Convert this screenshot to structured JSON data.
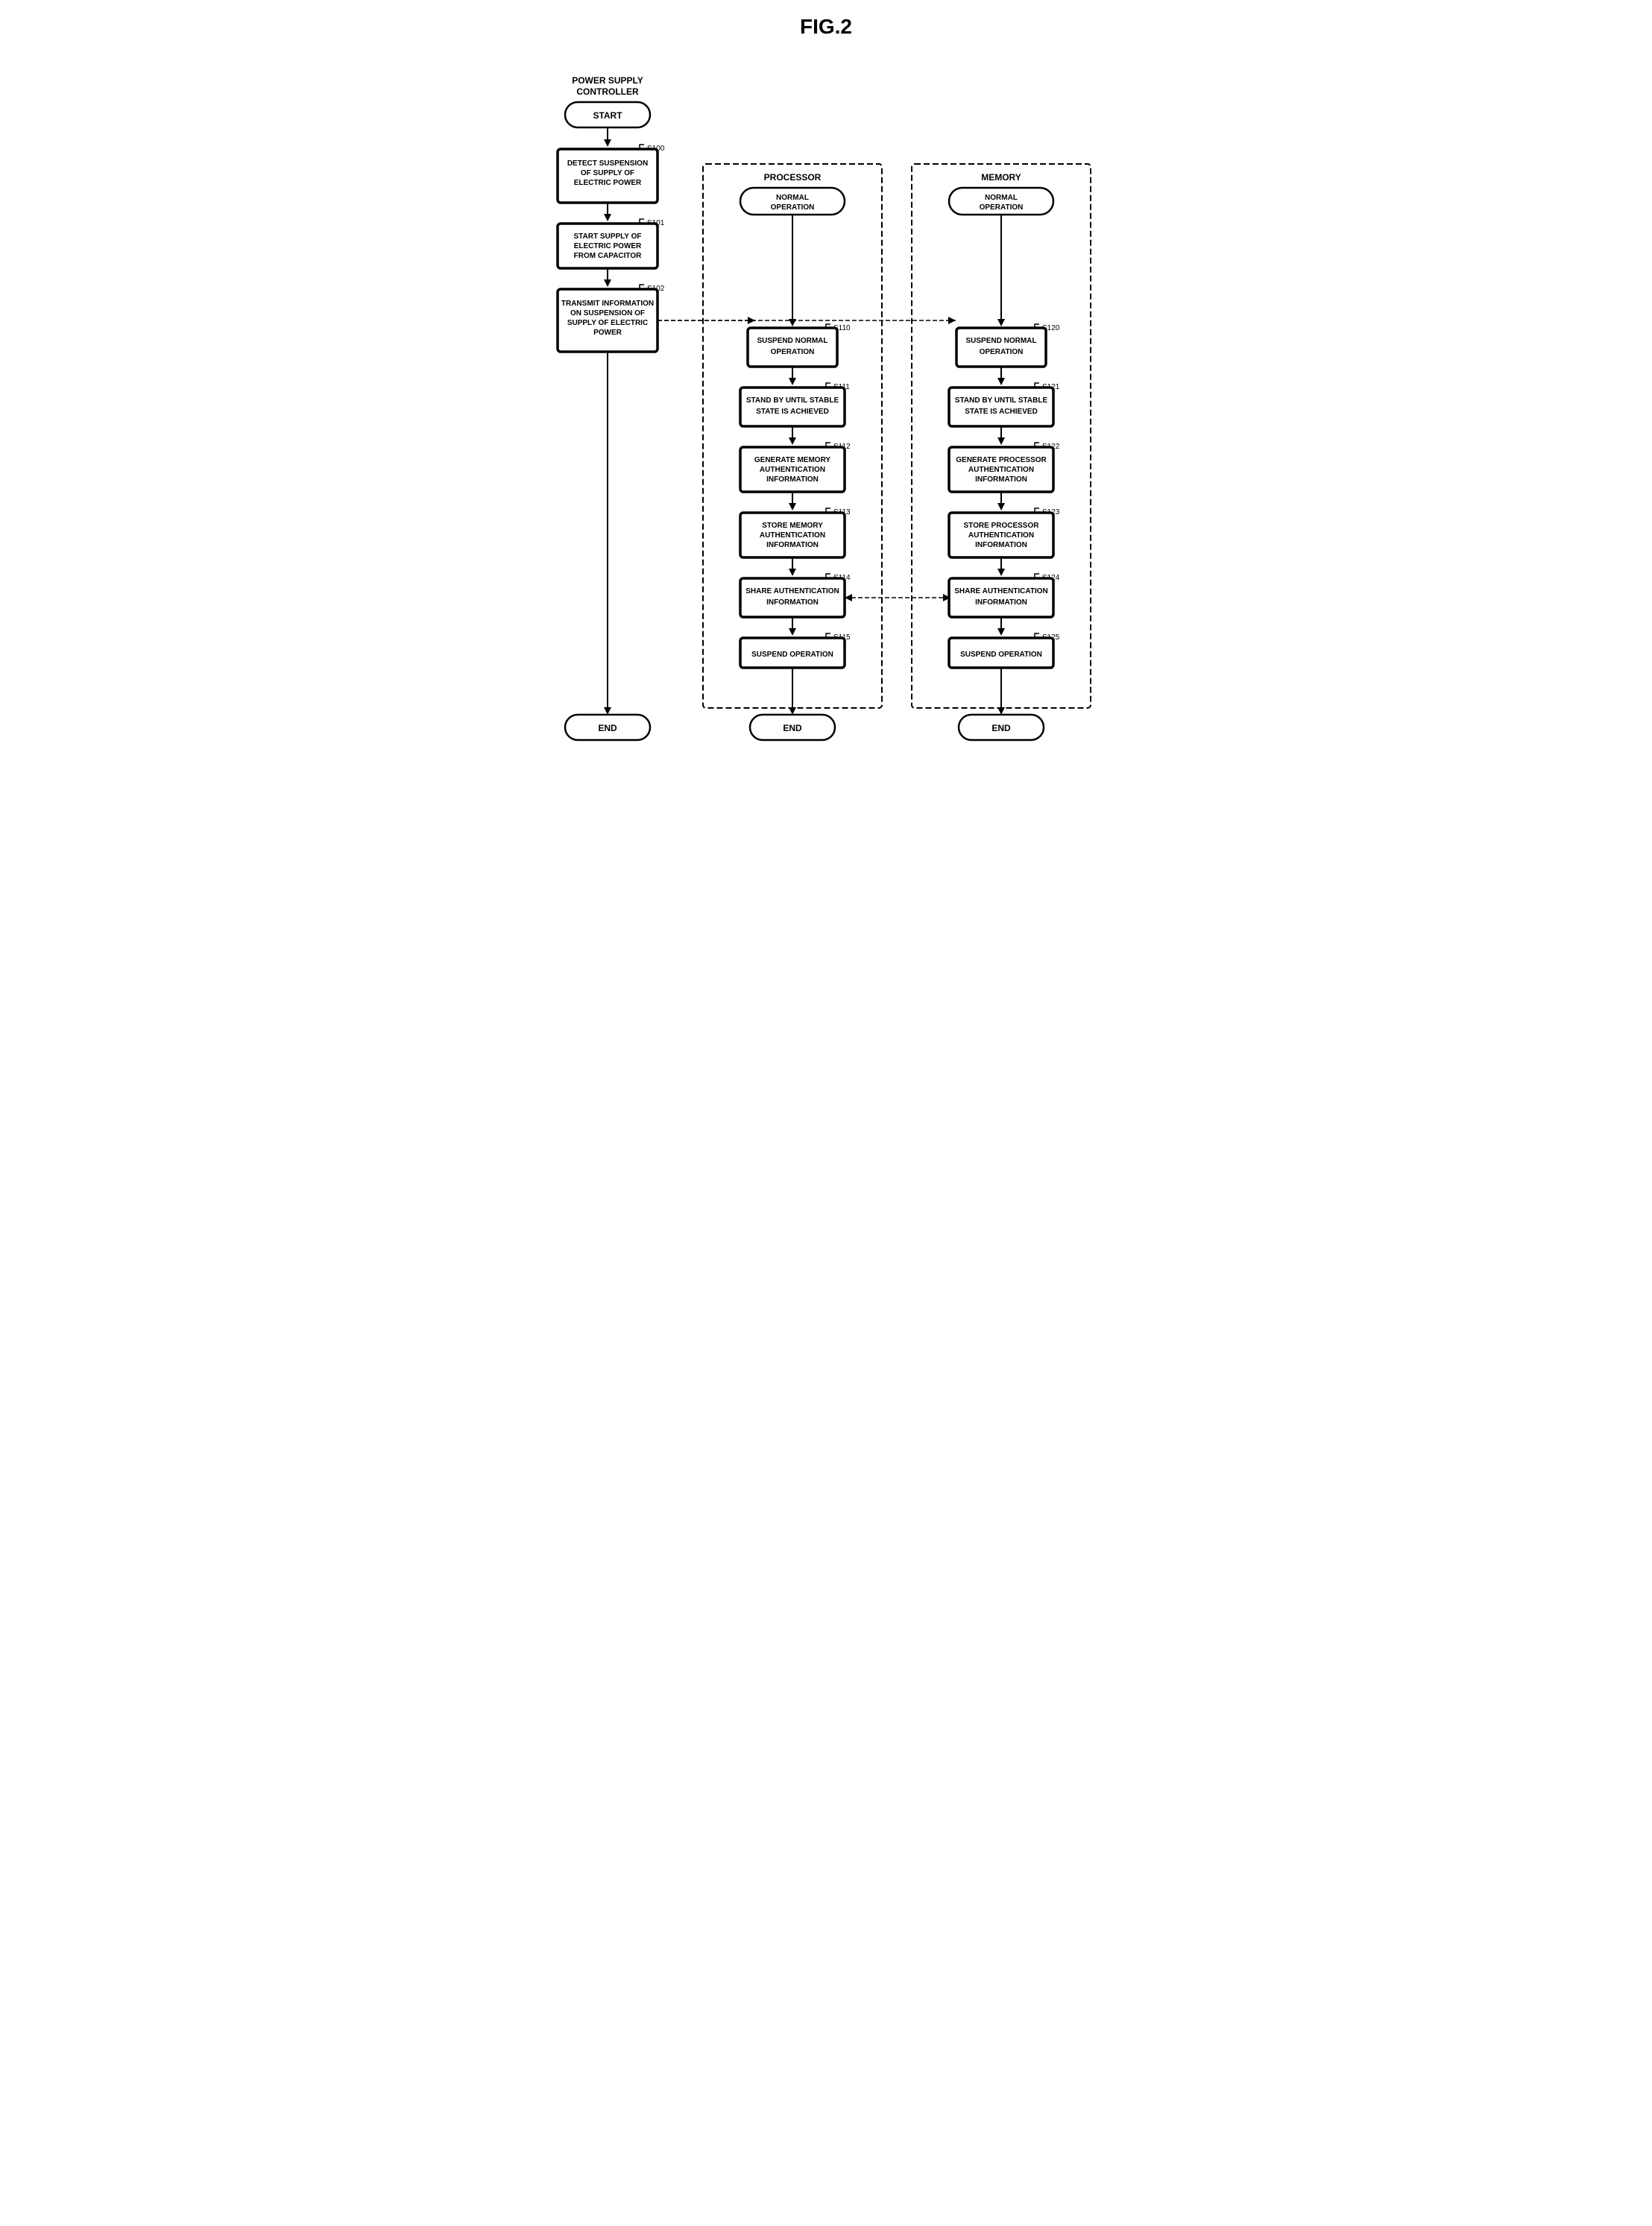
{
  "title": "FIG.2",
  "columns": {
    "left": {
      "header": "POWER SUPPLY\nCONTROLLER",
      "nodes": [
        {
          "id": "start",
          "type": "rounded",
          "label": "START"
        },
        {
          "id": "s100",
          "type": "rect-thick",
          "label": "DETECT SUSPENSION\nOF SUPPLY OF\nELECTRIC POWER",
          "step": "S100"
        },
        {
          "id": "s101",
          "type": "rect-thick",
          "label": "START SUPPLY OF\nELECTRIC POWER\nFROM CAPACITOR",
          "step": "S101"
        },
        {
          "id": "s102",
          "type": "rect-thick",
          "label": "TRANSMIT INFORMATION\nON SUSPENSION OF\nSUPPLY OF ELECTRIC\nPOWER",
          "step": "S102"
        },
        {
          "id": "end",
          "type": "rounded",
          "label": "END"
        }
      ]
    },
    "processor": {
      "header": "PROCESSOR",
      "nodes": [
        {
          "id": "proc-normal",
          "type": "rounded",
          "label": "NORMAL\nOPERATION"
        },
        {
          "id": "s110",
          "type": "rect-thick",
          "label": "SUSPEND NORMAL\nOPERATION",
          "step": "S110"
        },
        {
          "id": "s111",
          "type": "rect-thick",
          "label": "STAND BY UNTIL STABLE\nSTATE IS ACHIEVED",
          "step": "S111"
        },
        {
          "id": "s112",
          "type": "rect-thick",
          "label": "GENERATE MEMORY\nAUTHENTICATION\nINFORMATION",
          "step": "S112"
        },
        {
          "id": "s113",
          "type": "rect-thick",
          "label": "STORE MEMORY\nAUTHENTICATION\nINFORMATION",
          "step": "S113"
        },
        {
          "id": "s114",
          "type": "rect-thick",
          "label": "SHARE AUTHENTICATION\nINFORMATION",
          "step": "S114"
        },
        {
          "id": "s115",
          "type": "rect-thick",
          "label": "SUSPEND OPERATION",
          "step": "S115"
        },
        {
          "id": "proc-end",
          "type": "rounded",
          "label": "END"
        }
      ]
    },
    "memory": {
      "header": "MEMORY",
      "nodes": [
        {
          "id": "mem-normal",
          "type": "rounded",
          "label": "NORMAL\nOPERATION"
        },
        {
          "id": "s120",
          "type": "rect-thick",
          "label": "SUSPEND NORMAL\nOPERATION",
          "step": "S120"
        },
        {
          "id": "s121",
          "type": "rect-thick",
          "label": "STAND BY UNTIL STABLE\nSTATE IS ACHIEVED",
          "step": "S121"
        },
        {
          "id": "s122",
          "type": "rect-thick",
          "label": "GENERATE PROCESSOR\nAUTHENTICATION\nINFORMATION",
          "step": "S122"
        },
        {
          "id": "s123",
          "type": "rect-thick",
          "label": "STORE PROCESSOR\nAUTHENTICATION\nINFORMATION",
          "step": "S123"
        },
        {
          "id": "s124",
          "type": "rect-thick",
          "label": "SHARE AUTHENTICATION\nINFORMATION",
          "step": "S124"
        },
        {
          "id": "s125",
          "type": "rect-thick",
          "label": "SUSPEND OPERATION",
          "step": "S125"
        },
        {
          "id": "mem-end",
          "type": "rounded",
          "label": "END"
        }
      ]
    }
  }
}
